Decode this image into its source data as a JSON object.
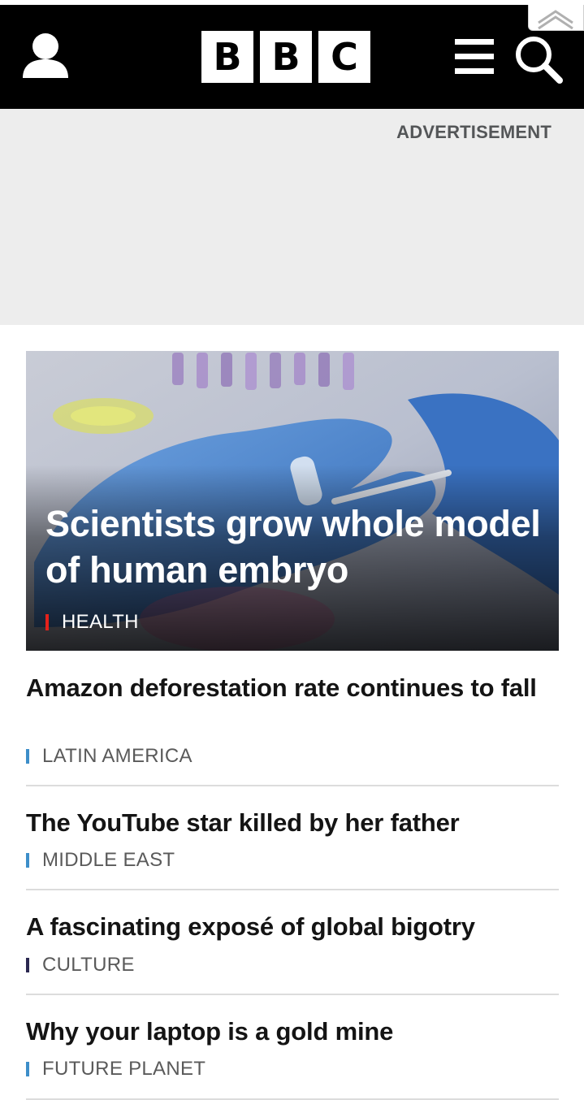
{
  "header": {
    "logo_letters": [
      "B",
      "B",
      "C"
    ],
    "account_icon": "user-icon",
    "menu_icon": "menu-icon",
    "search_icon": "search-icon",
    "collapse_icon": "double-chevron-up-icon"
  },
  "advertisement": {
    "label": "ADVERTISEMENT"
  },
  "hero": {
    "title": "Scientists grow whole model of human embryo",
    "tag": "HEALTH",
    "tag_color": "#e3211b"
  },
  "stories": [
    {
      "title": "Amazon deforestation rate continues to fall",
      "tag": "LATIN AMERICA",
      "tag_color": "#3d8ec9"
    },
    {
      "title": "The YouTube star killed by her father",
      "tag": "MIDDLE EAST",
      "tag_color": "#3d8ec9"
    },
    {
      "title": "A fascinating exposé of global bigotry",
      "tag": "CULTURE",
      "tag_color": "#2b2850"
    },
    {
      "title": "Why your laptop is a gold mine",
      "tag": "FUTURE PLANET",
      "tag_color": "#3d8ec9"
    }
  ],
  "colors": {
    "header_bg": "#000000",
    "ad_bg": "#ededed",
    "divider": "#dcdcdc"
  }
}
